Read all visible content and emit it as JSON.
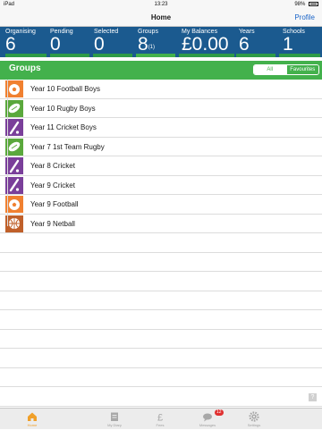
{
  "status_bar": {
    "carrier": "iPad",
    "time": "13:23",
    "battery": "98%"
  },
  "navbar": {
    "title": "Home",
    "profile": "Profile"
  },
  "stats": [
    {
      "label": "Organising",
      "value": "6",
      "sup": ""
    },
    {
      "label": "Pending",
      "value": "0",
      "sup": ""
    },
    {
      "label": "Selected",
      "value": "0",
      "sup": ""
    },
    {
      "label": "Groups",
      "value": "8",
      "sup": "(1)"
    },
    {
      "label": "My Balances",
      "value": "£0.00",
      "sup": ""
    },
    {
      "label": "Years",
      "value": "6",
      "sup": ""
    },
    {
      "label": "Schools",
      "value": "1",
      "sup": ""
    }
  ],
  "groups": {
    "title": "Groups",
    "filter_all": "All",
    "filter_favourites": "Favourites",
    "items": [
      {
        "name": "Year 10 Football Boys",
        "icon": "football-icon",
        "color": "#f08030"
      },
      {
        "name": "Year 10 Rugby Boys",
        "icon": "rugby-ball-icon",
        "color": "#5aa83c"
      },
      {
        "name": "Year 11 Cricket Boys",
        "icon": "cricket-bat-icon",
        "color": "#7a3f9a"
      },
      {
        "name": "Year 7 1st Team Rugby",
        "icon": "rugby-ball-icon",
        "color": "#5aa83c"
      },
      {
        "name": "Year 8 Cricket",
        "icon": "cricket-bat-icon",
        "color": "#7a3f9a"
      },
      {
        "name": "Year 9 Cricket",
        "icon": "cricket-bat-icon",
        "color": "#7a3f9a"
      },
      {
        "name": "Year 9 Football",
        "icon": "football-icon",
        "color": "#f08030"
      },
      {
        "name": "Year 9 Netball",
        "icon": "netball-icon",
        "color": "#c0602a"
      }
    ]
  },
  "help": "?",
  "tabbar": {
    "items": [
      {
        "label": "Home",
        "icon": "home-icon",
        "active": true
      },
      {
        "label": "My Diary",
        "icon": "diary-icon",
        "active": false
      },
      {
        "label": "Fees",
        "icon": "pound-icon",
        "active": false
      },
      {
        "label": "Messages",
        "icon": "messages-icon",
        "active": false,
        "badge": "12"
      },
      {
        "label": "Settings",
        "icon": "gear-icon",
        "active": false
      }
    ]
  },
  "colors": {
    "stats_bg": "#1b5a8f",
    "accent_green": "#43b14c",
    "active_tab": "#f0a02a"
  }
}
